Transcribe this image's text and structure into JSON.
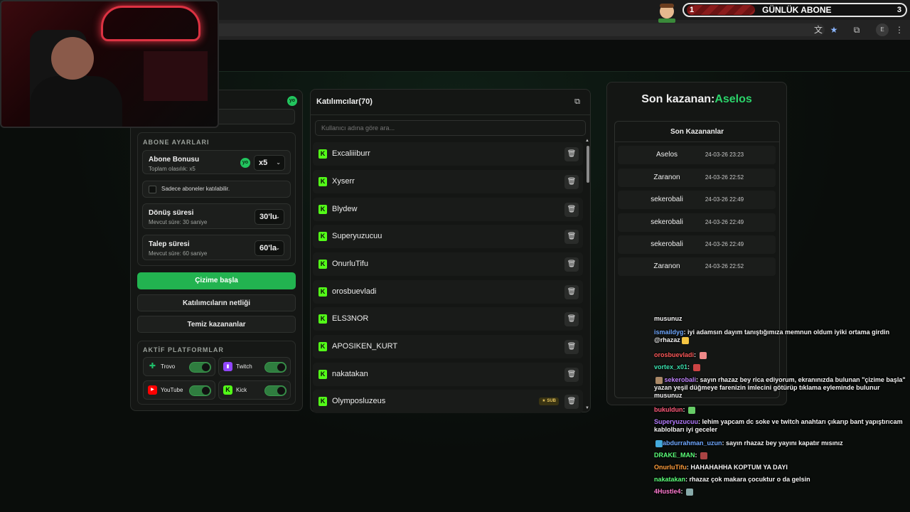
{
  "overlay": {
    "sub_goal": {
      "left_count": "1",
      "label": "GÜNLÜK ABONE",
      "right_count": "3"
    }
  },
  "settings": {
    "yo_badge": "yo",
    "section_title": "ABONE AYARLARI",
    "bonus": {
      "title": "Abone Bonusu",
      "subtitle": "Toplam olasılık: x5",
      "value": "x5",
      "badge": "yo"
    },
    "subs_only": {
      "label": "Sadece aboneler katılabilir."
    },
    "spin": {
      "title": "Dönüş süresi",
      "subtitle": "Mevcut süre: 30 saniye",
      "value": "30'lu"
    },
    "claim": {
      "title": "Talep süresi",
      "subtitle": "Mevcut süre: 60 saniye",
      "value": "60'la"
    },
    "buttons": {
      "start": "Çizime başla",
      "clear_participants": "Katılımcıların netliği",
      "clear_winners": "Temiz kazananlar"
    },
    "platforms_title": "AKTİF PLATFORMLAR",
    "platforms": [
      {
        "name": "Trovo",
        "color": "#1fbf6a",
        "icon": "trovo-icon"
      },
      {
        "name": "Twitch",
        "color": "#9146ff",
        "icon": "twitch-icon"
      },
      {
        "name": "YouTube",
        "color": "#ff0000",
        "icon": "youtube-icon"
      },
      {
        "name": "Kick",
        "color": "#53fc18",
        "icon": "kick-icon"
      }
    ]
  },
  "participants": {
    "title": "Katılımcılar(70)",
    "search_placeholder": "Kullanıcı adına göre ara...",
    "sub_badge": "SUB",
    "list": [
      "Excaliiiburr",
      "Xyserr",
      "Blydew",
      "Superyuzucuu",
      "OnurluTifu",
      "orosbuevladi",
      "ELS3NOR",
      "APOSIKEN_KURT",
      "nakatakan",
      "Olymposluzeus"
    ]
  },
  "winners": {
    "last_label": "Son kazanan:",
    "last_name": "Aselos",
    "title": "Son Kazananlar",
    "list": [
      {
        "name": "Aselos",
        "date": "24-03-26 23:23"
      },
      {
        "name": "Zaranon",
        "date": "24-03-26 22:52"
      },
      {
        "name": "sekerobali",
        "date": "24-03-26 22:49"
      },
      {
        "name": "sekerobali",
        "date": "24-03-26 22:49"
      },
      {
        "name": "sekerobali",
        "date": "24-03-26 22:49"
      },
      {
        "name": "Zaranon",
        "date": "24-03-26 22:52"
      }
    ]
  },
  "chat": [
    {
      "user": "",
      "text": "musunuz",
      "color": "#f4f4f4"
    },
    {
      "user": "ismaildyg",
      "text": "iyi adamsın dayım tanıştığımıza memnun oldum iyiki ortama girdin @rhazaz",
      "color": "#6fa8ff"
    },
    {
      "user": "orosbuevladi",
      "text": "",
      "color": "#ff5a5a"
    },
    {
      "user": "vortex_x01",
      "text": "",
      "color": "#3be3b0"
    },
    {
      "user": "sekerobali",
      "text": "sayın rhazaz bey rica ediyorum, ekranınızda bulunan \"çizime başla\" yazan yeşil düğmeye farenizin imlecini götürüp tıklama eyleminde bulunur musunuz",
      "color": "#c084fc"
    },
    {
      "user": "bukuldun",
      "text": "",
      "color": "#ff5a7a"
    },
    {
      "user": "Superyuzucuu",
      "text": "lehim yapcam dc soke ve twitch anahtarı çıkarıp bant yapıştırıcam kablolbarı iyi geceler",
      "color": "#b47cff"
    },
    {
      "user": "abdurrahman_uzun",
      "text": "sayın rhazaz bey yayını kapatır mısınız",
      "color": "#6fa8ff"
    },
    {
      "user": "DRAKE_MAN",
      "text": "",
      "color": "#5cff7a"
    },
    {
      "user": "OnurluTifu",
      "text": "HAHAHAHHA KOPTUM YA DAYI",
      "color": "#ff9d3b"
    },
    {
      "user": "nakatakan",
      "text": "rhazaz çok makara çocuktur o da gelsin",
      "color": "#5cff7a"
    },
    {
      "user": "4Hustle4",
      "text": "",
      "color": "#ff7ad0"
    }
  ]
}
